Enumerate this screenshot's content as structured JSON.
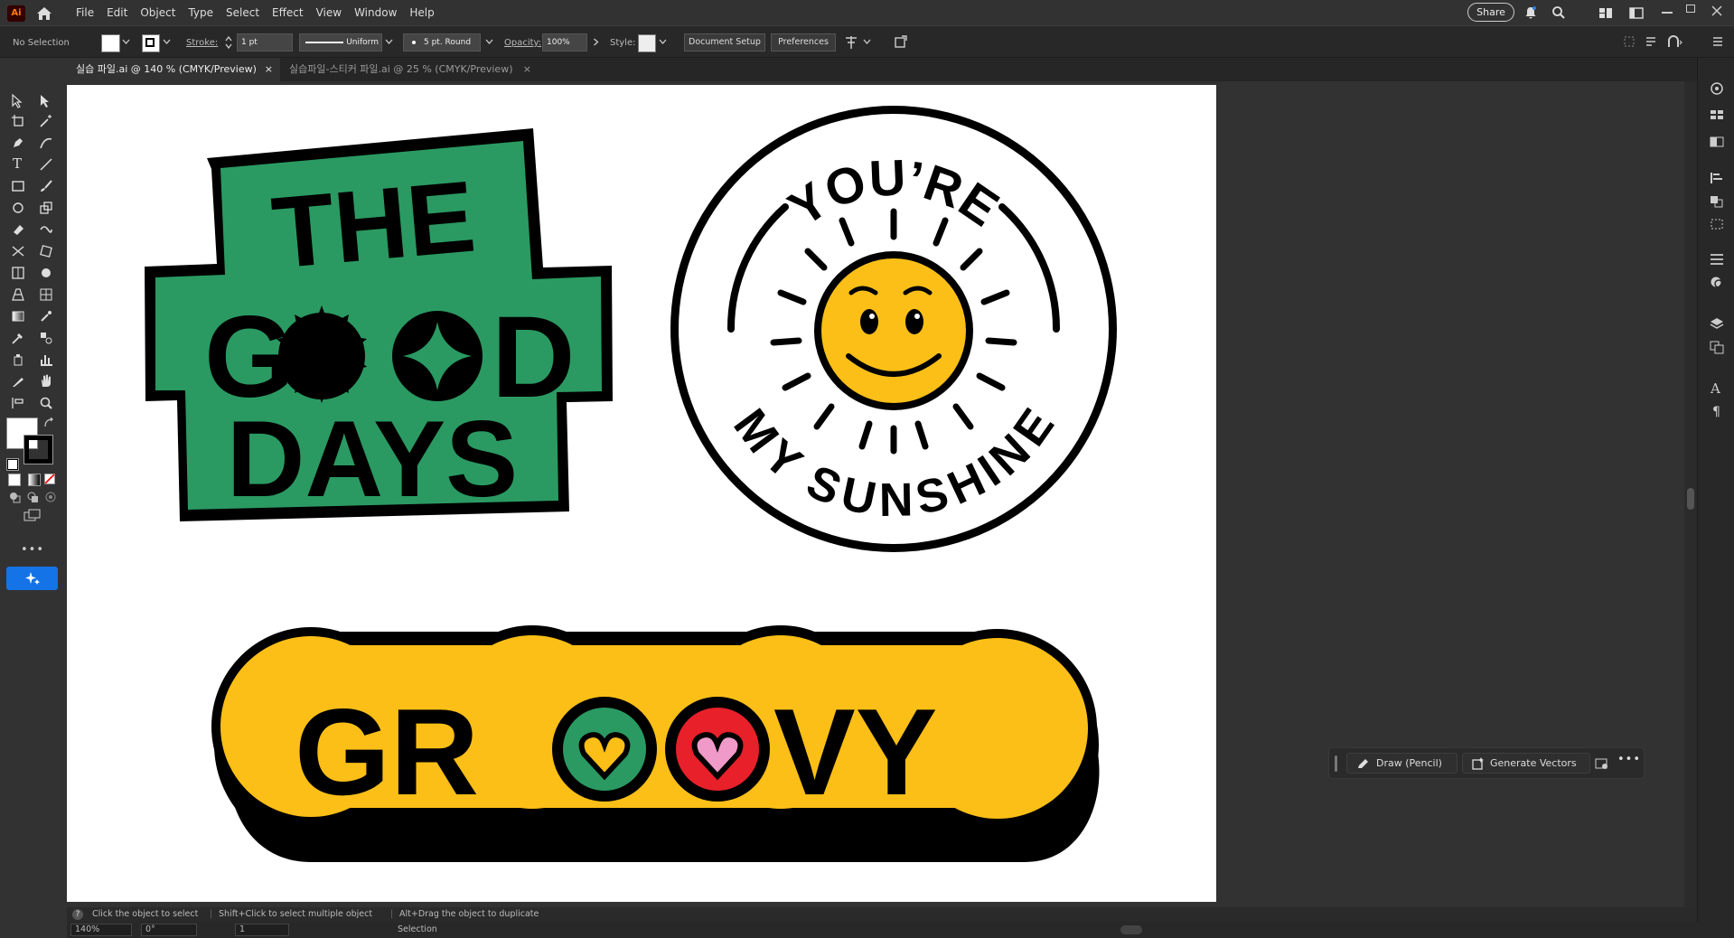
{
  "app": {
    "logo": "Ai"
  },
  "menu": [
    "File",
    "Edit",
    "Object",
    "Type",
    "Select",
    "Effect",
    "View",
    "Window",
    "Help"
  ],
  "header": {
    "share": "Share"
  },
  "control_bar": {
    "selection": "No Selection",
    "stroke_label": "Stroke:",
    "stroke_value": "1 pt",
    "profile": "Uniform",
    "brush": "5 pt. Round",
    "opacity_label": "Opacity:",
    "opacity_value": "100%",
    "style_label": "Style:",
    "document_setup": "Document Setup",
    "preferences": "Preferences"
  },
  "tabs": [
    {
      "label": "실습 파일.ai @ 140 % (CMYK/Preview)",
      "active": true
    },
    {
      "label": "실습파일-스티커 파일.ai @ 25 % (CMYK/Preview)",
      "active": false
    }
  ],
  "artwork": {
    "sticker1": {
      "line1": "THE",
      "line2a": "G",
      "line2b": "D",
      "line3": "DAYS",
      "color": "#2a9a62"
    },
    "sticker2": {
      "top": "YOU’RE",
      "bottom": "MY SUNSHINE",
      "sun_color": "#fbbf17"
    },
    "sticker3": {
      "left": "GR",
      "right": "VY",
      "color": "#fbbf17",
      "o1_color": "#2a9a62",
      "o2_color": "#e8202a",
      "heart1": "#fbbf17",
      "heart2": "#ef9ac8"
    }
  },
  "task_bar": {
    "draw": "Draw (Pencil)",
    "generate": "Generate Vectors"
  },
  "status": {
    "hint1": "Click the object to select",
    "hint2": "Shift+Click to select multiple object",
    "hint3": "Alt+Drag the object to duplicate",
    "zoom": "140%",
    "rotation": "0°",
    "artboard": "1",
    "tool": "Selection"
  }
}
